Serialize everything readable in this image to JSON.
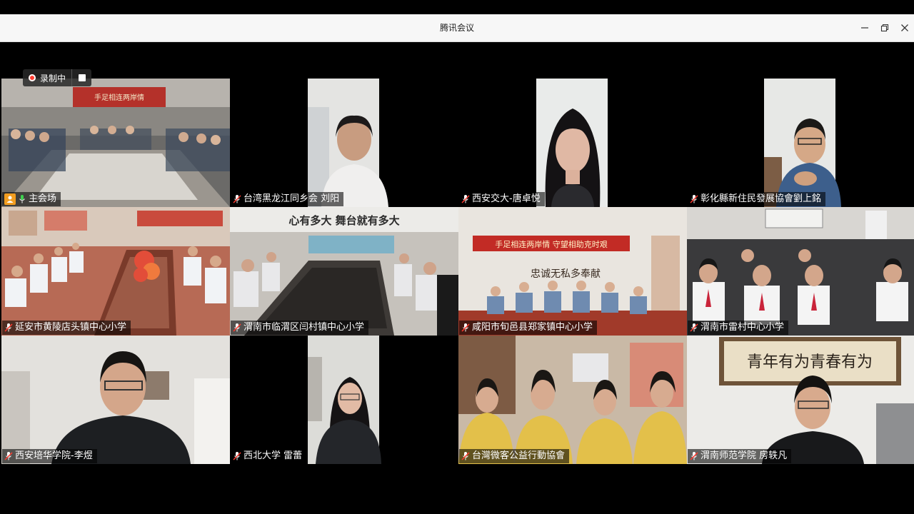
{
  "window": {
    "title": "腾讯会议",
    "minimize_icon": "minimize-icon",
    "restore_icon": "restore-icon",
    "close_icon": "close-icon"
  },
  "recording": {
    "label": "录制中",
    "indicator_color": "#ff3b30"
  },
  "host_badge_color": "#f29d20",
  "participants": [
    {
      "name": "主会场",
      "host": true
    },
    {
      "name": "台湾黑龙江同乡会 刘阳"
    },
    {
      "name": "西安交大-唐卓悦"
    },
    {
      "name": "彰化縣新住民發展協會劉上銘"
    },
    {
      "name": "延安市黄陵店头镇中心小学"
    },
    {
      "name": "渭南市临渭区闫村镇中心小学"
    },
    {
      "name": "咸阳市旬邑县郑家镇中心小学"
    },
    {
      "name": "渭南市雷村中心小学"
    },
    {
      "name": "西安培华学院-李煜"
    },
    {
      "name": "西北大学 雷蕾"
    },
    {
      "name": "台灣微客公益行動協會"
    },
    {
      "name": "渭南师范学院  房轶凡"
    }
  ],
  "banners": {
    "main_hall_banner": "手足相连两岸情",
    "zhengjia_banner": "手足相连两岸情   守望相助克时艰",
    "zhengjia_wall": "忠诚无私多奉献",
    "yancun_wall": "心有多大  舞台就有多大",
    "weinan_calligraphy": "青年有为青春有为"
  }
}
